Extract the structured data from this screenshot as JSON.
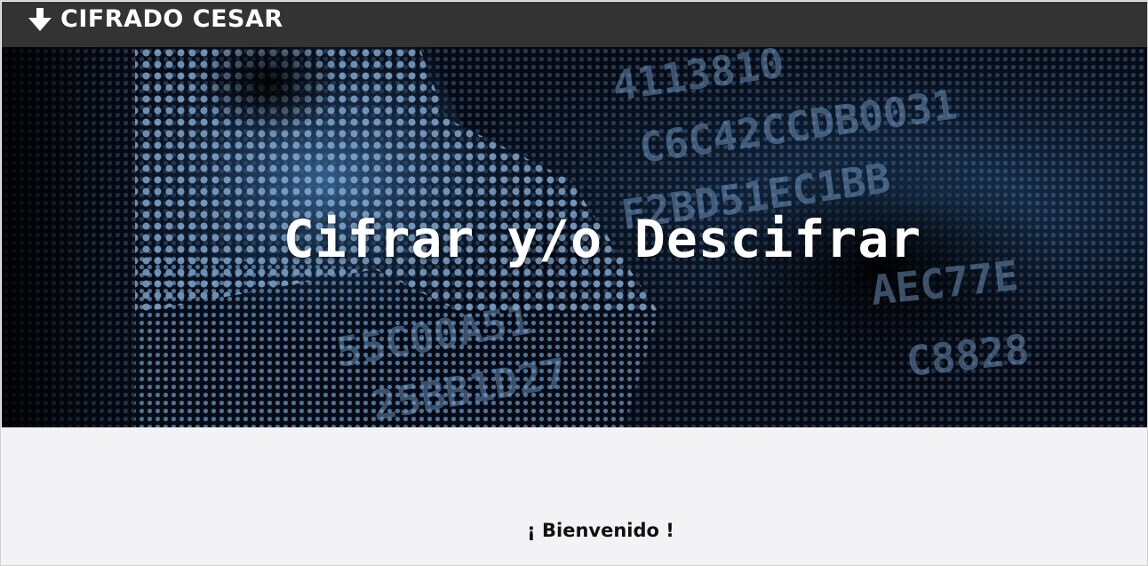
{
  "header": {
    "brand_label": "CIFRADO CESAR",
    "brand_icon": "arrow-down-icon"
  },
  "hero": {
    "title": "Cifrar y/o Descifrar"
  },
  "main": {
    "welcome_text": "¡ Bienvenido !"
  },
  "colors": {
    "topbar": "#333333",
    "page_background": "#f3f3f5",
    "hero_dark": "#050a14",
    "hero_blue": "#6f9fd0"
  }
}
